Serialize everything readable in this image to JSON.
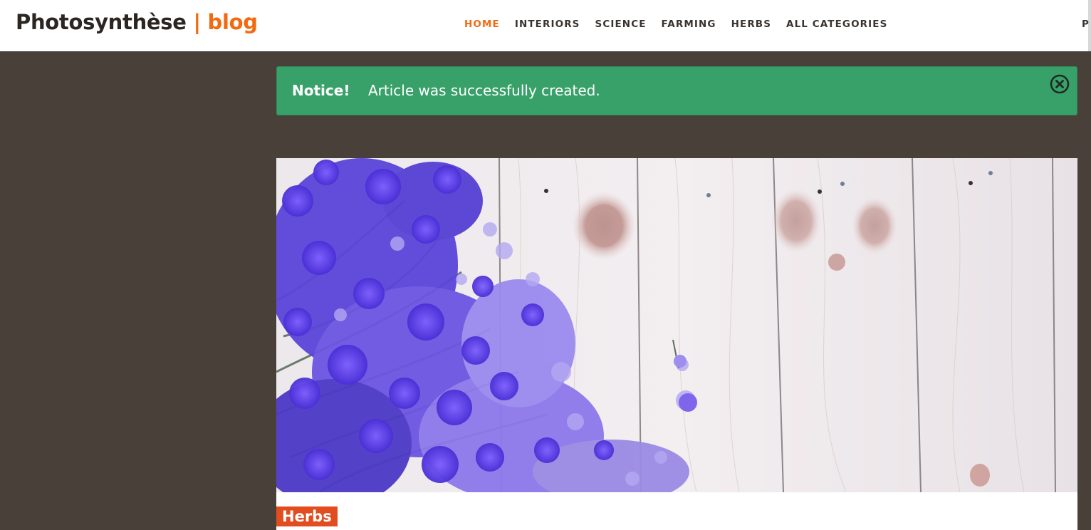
{
  "header": {
    "brand_name": "Photosynthèse",
    "brand_separator": "| blog",
    "nav": [
      {
        "label": "HOME",
        "active": true
      },
      {
        "label": "INTERIORS",
        "active": false
      },
      {
        "label": "SCIENCE",
        "active": false
      },
      {
        "label": "FARMING",
        "active": false
      },
      {
        "label": "HERBS",
        "active": false
      },
      {
        "label": "ALL CATEGORIES",
        "active": false
      }
    ],
    "nav_overflow_label": "P"
  },
  "notice": {
    "label": "Notice!",
    "message": "Article was successfully created.",
    "close_icon": "close-circle-icon"
  },
  "article": {
    "image_icon": "purple-flowers-on-wooden-planks",
    "category": "Herbs"
  },
  "colors": {
    "accent": "#f26a10",
    "page_background": "#4a403a",
    "notice_background": "#38a169",
    "category_badge": "#e14d1f"
  }
}
